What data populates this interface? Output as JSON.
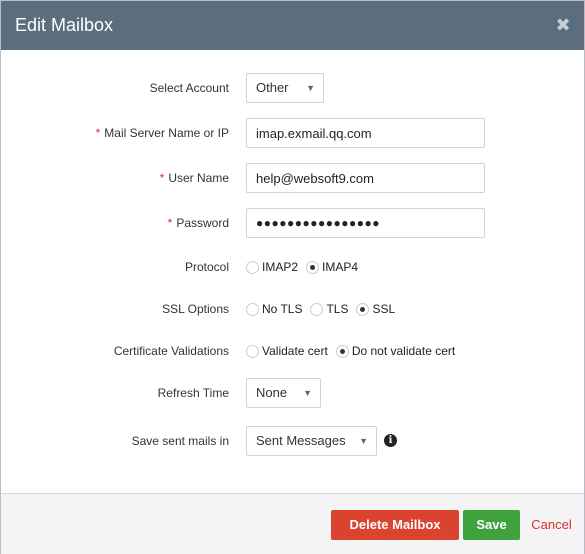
{
  "dialog": {
    "title": "Edit Mailbox",
    "close_icon": "close-icon"
  },
  "fields": {
    "account": {
      "label": "Select Account",
      "value": "Other"
    },
    "server": {
      "required": "*",
      "label": "Mail Server Name or IP",
      "value": "imap.exmail.qq.com"
    },
    "username": {
      "required": "*",
      "label": "User Name",
      "value": "help@websoft9.com"
    },
    "password": {
      "required": "*",
      "label": "Password",
      "value": "●●●●●●●●●●●●●●●●"
    },
    "protocol": {
      "label": "Protocol",
      "options": [
        "IMAP2",
        "IMAP4"
      ],
      "selected": "IMAP4"
    },
    "ssl": {
      "label": "SSL Options",
      "options": [
        "No TLS",
        "TLS",
        "SSL"
      ],
      "selected": "SSL"
    },
    "cert": {
      "label": "Certificate Validations",
      "options": [
        "Validate cert",
        "Do not validate cert"
      ],
      "selected": "Do not validate cert"
    },
    "refresh": {
      "label": "Refresh Time",
      "value": "None"
    },
    "sent": {
      "label": "Save sent mails in",
      "value": "Sent Messages",
      "info_icon": "info-icon"
    }
  },
  "footer": {
    "delete_label": "Delete Mailbox",
    "save_label": "Save",
    "cancel_label": "Cancel"
  },
  "colors": {
    "header": "#5b6e7e",
    "delete": "#d9432f",
    "save": "#3fa23c",
    "required": "#d9312b"
  }
}
